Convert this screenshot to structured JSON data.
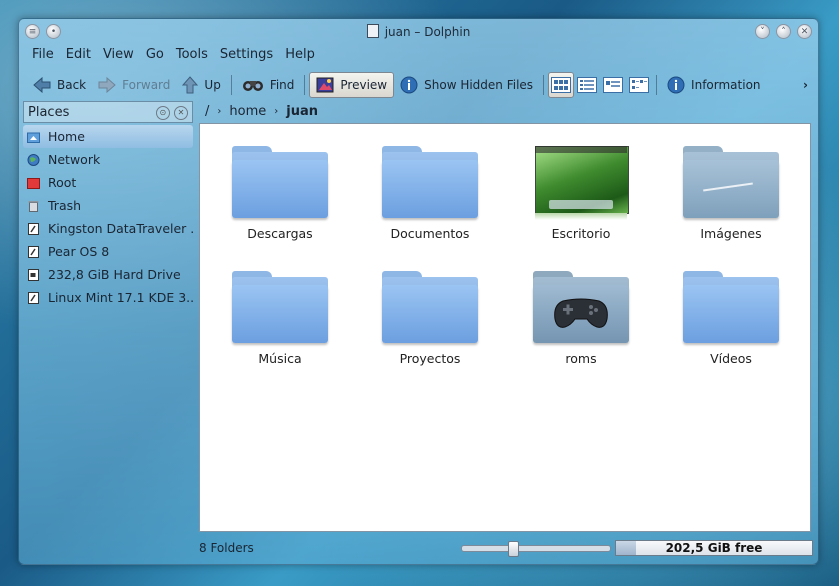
{
  "window": {
    "title": "juan – Dolphin"
  },
  "menu": [
    "File",
    "Edit",
    "View",
    "Go",
    "Tools",
    "Settings",
    "Help"
  ],
  "toolbar": {
    "back": "Back",
    "forward": "Forward",
    "up": "Up",
    "find": "Find",
    "preview": "Preview",
    "show_hidden": "Show Hidden Files",
    "information": "Information",
    "overflow": "›"
  },
  "places": {
    "title": "Places",
    "items": [
      {
        "label": "Home",
        "icon": "home-icon"
      },
      {
        "label": "Network",
        "icon": "network-icon"
      },
      {
        "label": "Root",
        "icon": "root-folder-icon"
      },
      {
        "label": "Trash",
        "icon": "trash-icon"
      },
      {
        "label": "Kingston DataTraveler ...",
        "icon": "usb-drive-icon"
      },
      {
        "label": "Pear OS 8",
        "icon": "optical-disc-icon"
      },
      {
        "label": "232,8 GiB Hard Drive",
        "icon": "hard-drive-icon"
      },
      {
        "label": "Linux Mint 17.1 KDE 3...",
        "icon": "optical-disc-icon"
      }
    ]
  },
  "breadcrumb": {
    "root": "/",
    "parts": [
      "home",
      "juan"
    ]
  },
  "files": [
    {
      "name": "Descargas",
      "kind": "folder"
    },
    {
      "name": "Documentos",
      "kind": "folder"
    },
    {
      "name": "Escritorio",
      "kind": "folder-preview"
    },
    {
      "name": "Imágenes",
      "kind": "folder-images"
    },
    {
      "name": "Música",
      "kind": "folder"
    },
    {
      "name": "Proyectos",
      "kind": "folder"
    },
    {
      "name": "roms",
      "kind": "folder-gamepad"
    },
    {
      "name": "Vídeos",
      "kind": "folder"
    }
  ],
  "status": {
    "summary": "8 Folders",
    "zoom_level": 0.33,
    "free_space": "202,5 GiB free",
    "used_fraction": 0.1
  },
  "colors": {
    "folder_blue": "#7aa8de",
    "selection": "#8fbde2"
  }
}
